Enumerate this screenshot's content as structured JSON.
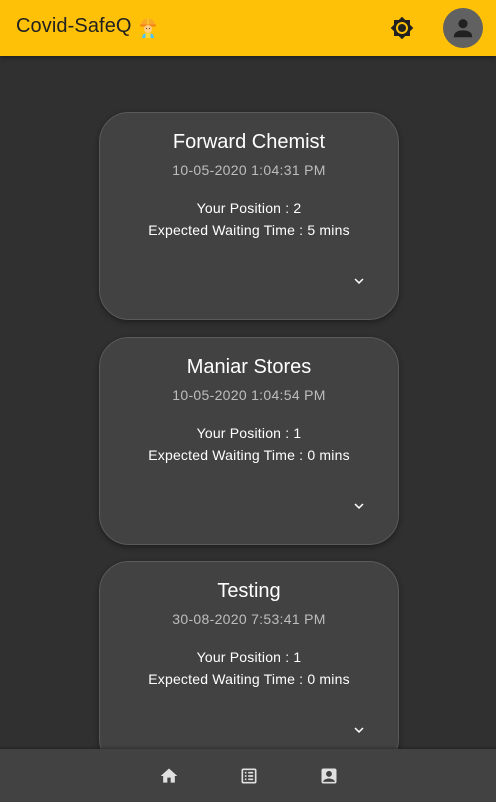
{
  "appbar": {
    "title": "Covid-SafeQ",
    "title_icon": "construction-worker-icon",
    "theme_icon": "brightness-icon",
    "account_icon": "account-circle-icon",
    "background": "#ffc107"
  },
  "queue_cards": [
    {
      "store": "Forward Chemist",
      "timestamp": "10-05-2020 1:04:31 PM",
      "position": "Your Position : 2",
      "waiting": "Expected Waiting Time : 5 mins"
    },
    {
      "store": "Maniar Stores",
      "timestamp": "10-05-2020 1:04:54 PM",
      "position": "Your Position : 1",
      "waiting": "Expected Waiting Time : 0 mins"
    },
    {
      "store": "Testing",
      "timestamp": "30-08-2020 7:53:41 PM",
      "position": "Your Position : 1",
      "waiting": "Expected Waiting Time : 0 mins"
    }
  ],
  "bottom_nav": {
    "items": [
      "home-icon",
      "list-icon",
      "contact-icon"
    ]
  },
  "colors": {
    "background": "#303030",
    "card": "#424242",
    "accent": "#ffc107"
  }
}
